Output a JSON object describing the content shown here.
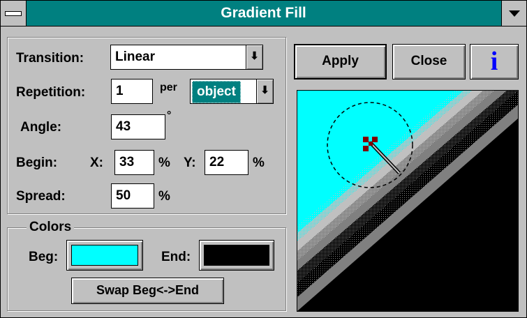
{
  "window": {
    "title": "Gradient Fill"
  },
  "transition": {
    "label": "Transition:",
    "value": "Linear"
  },
  "repetition": {
    "label": "Repetition:",
    "value": "1",
    "per_label": "per",
    "unit_value": "object"
  },
  "angle": {
    "label": "Angle:",
    "value": "43",
    "unit": "°"
  },
  "begin": {
    "label": "Begin:",
    "x_label": "X:",
    "x_value": "33",
    "x_unit": "%",
    "y_label": "Y:",
    "y_value": "22",
    "y_unit": "%"
  },
  "spread": {
    "label": "Spread:",
    "value": "50",
    "unit": "%"
  },
  "colors": {
    "group_label": "Colors",
    "beg_label": "Beg:",
    "end_label": "End:",
    "beg_color": "#00ffff",
    "end_color": "#000000",
    "swap_label": "Swap Beg<->End"
  },
  "buttons": {
    "apply": "Apply",
    "close": "Close",
    "info": "i"
  },
  "icons": {
    "system_menu": "system-menu-icon",
    "window_dropdown": "dropdown-arrow-icon",
    "combo_arrow": "combo-arrow-icon",
    "info": "info-icon"
  }
}
